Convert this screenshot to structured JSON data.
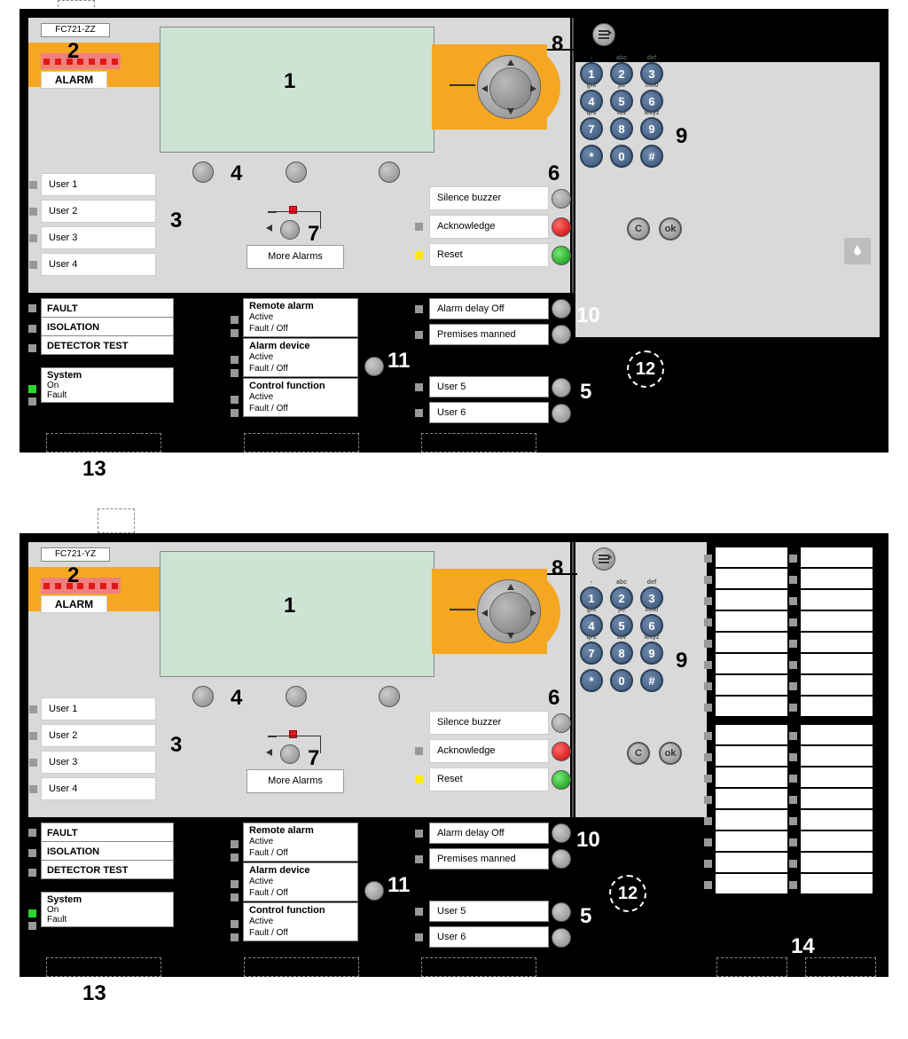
{
  "panels": {
    "p1": {
      "model": "FC721-ZZ",
      "hasLedGroups": false
    },
    "p2": {
      "model": "FC721-YZ",
      "hasLedGroups": true
    }
  },
  "alarm_label": "ALARM",
  "users": [
    "User 1",
    "User 2",
    "User 3",
    "User 4"
  ],
  "more_alarms": "More Alarms",
  "ack": {
    "silence": "Silence buzzer",
    "acknowledge": "Acknowledge",
    "reset": "Reset"
  },
  "status": {
    "fault": "FAULT",
    "isolation": "ISOLATION",
    "detector": "DETECTOR TEST"
  },
  "system": {
    "title": "System",
    "on": "On",
    "fault": "Fault"
  },
  "func": {
    "remote": {
      "title": "Remote alarm",
      "a": "Active",
      "b": "Fault / Off"
    },
    "device": {
      "title": "Alarm device",
      "a": "Active",
      "b": "Fault / Off"
    },
    "control": {
      "title": "Control function",
      "a": "Active",
      "b": "Fault / Off"
    }
  },
  "midright": {
    "delay": "Alarm delay Off",
    "manned": "Premises manned",
    "u5": "User 5",
    "u6": "User 6"
  },
  "keypad": {
    "labels": {
      "1": "-",
      "2": "abc",
      "3": "def",
      "4": "ghi",
      "5": "jkl",
      "6": "mno",
      "7": "qrs",
      "8": "tuv",
      "9": "wxyz"
    },
    "star": "*",
    "zero": "0",
    "hash": "#",
    "c": "C",
    "ok": "ok"
  },
  "callouts": {
    "1": "1",
    "2": "2",
    "3": "3",
    "4": "4",
    "5": "5",
    "6": "6",
    "7": "7",
    "8": "8",
    "9": "9",
    "10": "10",
    "11": "11",
    "12": "12",
    "13": "13",
    "14": "14"
  }
}
